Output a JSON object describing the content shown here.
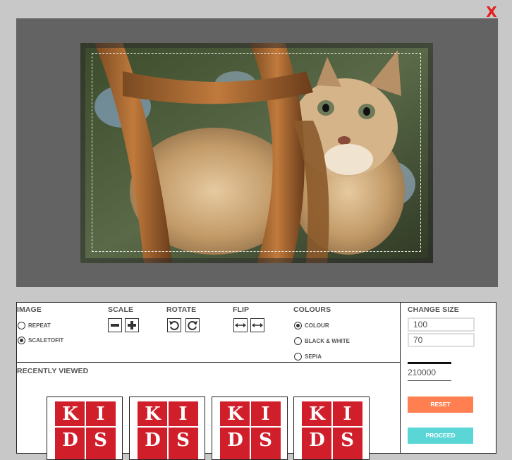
{
  "close_label": "X",
  "tools": {
    "image": {
      "heading": "IMAGE",
      "options": [
        {
          "label": "REPEAT",
          "selected": false
        },
        {
          "label": "SCALETOFIT",
          "selected": true
        }
      ]
    },
    "scale": {
      "heading": "SCALE",
      "buttons": [
        "minus-icon",
        "plus-icon"
      ]
    },
    "rotate": {
      "heading": "ROTATE",
      "buttons": [
        "rotate-left-icon",
        "rotate-right-icon"
      ]
    },
    "flip": {
      "heading": "FLIP",
      "buttons": [
        "flip-horizontal-icon",
        "flip-vertical-icon"
      ]
    },
    "colours": {
      "heading": "COLOURS",
      "options": [
        {
          "label": "COLOUR",
          "selected": true
        },
        {
          "label": "BLACK & WHITE",
          "selected": false
        },
        {
          "label": "SEPIA",
          "selected": false
        }
      ]
    }
  },
  "recent": {
    "heading": "RECENTLY VIEWED",
    "thumb_letters": [
      "K",
      "I",
      "D",
      "S"
    ]
  },
  "change_size": {
    "heading": "CHANGE SIZE",
    "width": "100",
    "height": "70",
    "total": "210000",
    "reset_label": "RESET",
    "proceed_label": "PROCEED"
  },
  "colors": {
    "close": "#e81d1d",
    "reset": "#ff7f50",
    "proceed": "#5bd6d6",
    "logo": "#d01f2b"
  }
}
